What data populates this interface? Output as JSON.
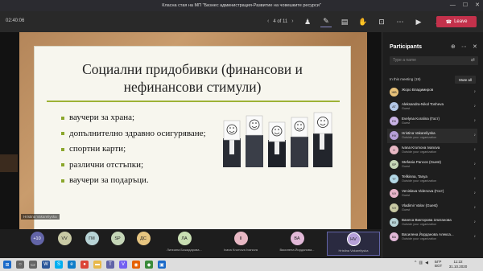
{
  "window": {
    "title": "Класна стая на МП \"Бизнес администрация-Развитие на човешките ресурси\"",
    "controls": [
      "—",
      "☐",
      "✕"
    ]
  },
  "meeting": {
    "timer": "02:40:06",
    "slide_counter": "4 of 11",
    "leave_label": "Leave",
    "tools": [
      "person-icon",
      "pen-icon",
      "chat-icon",
      "hand-icon",
      "rooms-icon",
      "more-icon",
      "video-icon",
      "mic-icon",
      "share-icon"
    ]
  },
  "slide": {
    "title_line1": "Социални придобивки (финансови и",
    "title_line2": "нефинансови стимули)",
    "bullets": [
      "ваучери за храна;",
      "допълнително здравно осигуряване;",
      "спортни карти;",
      "различни отстъпки;",
      "ваучери за подаръци."
    ],
    "presenter_label": "Hristina Vakareliyska"
  },
  "strip": {
    "overflow": "+10",
    "tiles": [
      {
        "initials": "VV",
        "color": "#c8c9a4"
      },
      {
        "initials": "ГМ",
        "color": "#b7d3d6"
      },
      {
        "initials": "SP",
        "color": "#c5d6b7"
      },
      {
        "initials": "ДС",
        "color": "#e6c580"
      }
    ],
    "named": [
      {
        "initials": "ЛА",
        "name": "Лилиана Божидарова...",
        "color": "#c9dfb3"
      },
      {
        "initials": "II",
        "name": "Ivana Krumova Ivanova",
        "color": "#e8b8c4"
      },
      {
        "initials": "ВА",
        "name": "Василена Йорданова...",
        "color": "#e2b9d8"
      },
      {
        "initials": "HV",
        "name": "Hristina Vakareliyska",
        "color": "#b59fd8"
      }
    ]
  },
  "panel": {
    "title": "Participants",
    "search_placeholder": "Type a name",
    "section": "In this meeting (19)",
    "mute_all": "Mute all",
    "people": [
      {
        "initials": "ЖВ",
        "name": "Жоро Владимиров",
        "status": "",
        "color": "#e8c27a"
      },
      {
        "initials": "AT",
        "name": "Aleksandra-Nikol Tosheva",
        "status": "Guest",
        "color": "#b3c7e6"
      },
      {
        "initials": "ЕК",
        "name": "Evelyna Koralina (Гост)",
        "status": "Guest",
        "color": "#c9b3e6"
      },
      {
        "initials": "HV",
        "name": "Hristina Vakareliyska",
        "status": "Outside your organization",
        "color": "#b59fd8"
      },
      {
        "initials": "II",
        "name": "Ivana Krumova Ivanova",
        "status": "Outside your organization",
        "color": "#e8b8c4"
      },
      {
        "initials": "SP",
        "name": "Stefania Pancos (Guest)",
        "status": "Guest",
        "color": "#c5d6b7"
      },
      {
        "initials": "TT",
        "name": "Tellkinna, Tanya",
        "status": "Outside your organization",
        "color": "#b3d8e6"
      },
      {
        "initials": "VV",
        "name": "Venislava Videnova (Гост)",
        "status": "Guest",
        "color": "#e6b3c9"
      },
      {
        "initials": "VV",
        "name": "Vladimir Valov (Guest)",
        "status": "Guest",
        "color": "#c8c9a4"
      },
      {
        "initials": "ВЗ",
        "name": "Ванеса Викторова Златанова",
        "status": "Outside your organization",
        "color": "#b7d3d6"
      },
      {
        "initials": "ВА",
        "name": "Василена Йорданова Алекса...",
        "status": "Outside your organization",
        "color": "#e2b9d8"
      }
    ]
  },
  "taskbar": {
    "apps": [
      {
        "icon": "windows-start-icon",
        "glyph": "⊞",
        "color": "#1b6ac9"
      },
      {
        "icon": "search-icon",
        "glyph": "○",
        "color": "#666666"
      },
      {
        "icon": "task-view-icon",
        "glyph": "▭",
        "color": "#666666"
      },
      {
        "icon": "word-icon",
        "glyph": "W",
        "color": "#2b579a"
      },
      {
        "icon": "skype-icon",
        "glyph": "S",
        "color": "#00aff0"
      },
      {
        "icon": "edge-icon",
        "glyph": "e",
        "color": "#0f7dc9"
      },
      {
        "icon": "chrome-icon",
        "glyph": "●",
        "color": "#db4437"
      },
      {
        "icon": "folder-icon",
        "glyph": "▬",
        "color": "#e8b84a"
      },
      {
        "icon": "teams-icon",
        "glyph": "T",
        "color": "#6264a7"
      },
      {
        "icon": "viber-icon",
        "glyph": "V",
        "color": "#7360f2"
      },
      {
        "icon": "firefox-icon",
        "glyph": "◉",
        "color": "#e66000"
      },
      {
        "icon": "app-icon",
        "glyph": "◆",
        "color": "#3a8b3a"
      },
      {
        "icon": "store-icon",
        "glyph": "▣",
        "color": "#1b6ac9"
      }
    ],
    "lang_top": "БГР",
    "lang_bottom": "BGT",
    "time": "11:22",
    "date": "31.10.2020"
  },
  "colors": {
    "accent": "#6264a7",
    "leave": "#c4314b",
    "slide_rule": "#9db236"
  }
}
